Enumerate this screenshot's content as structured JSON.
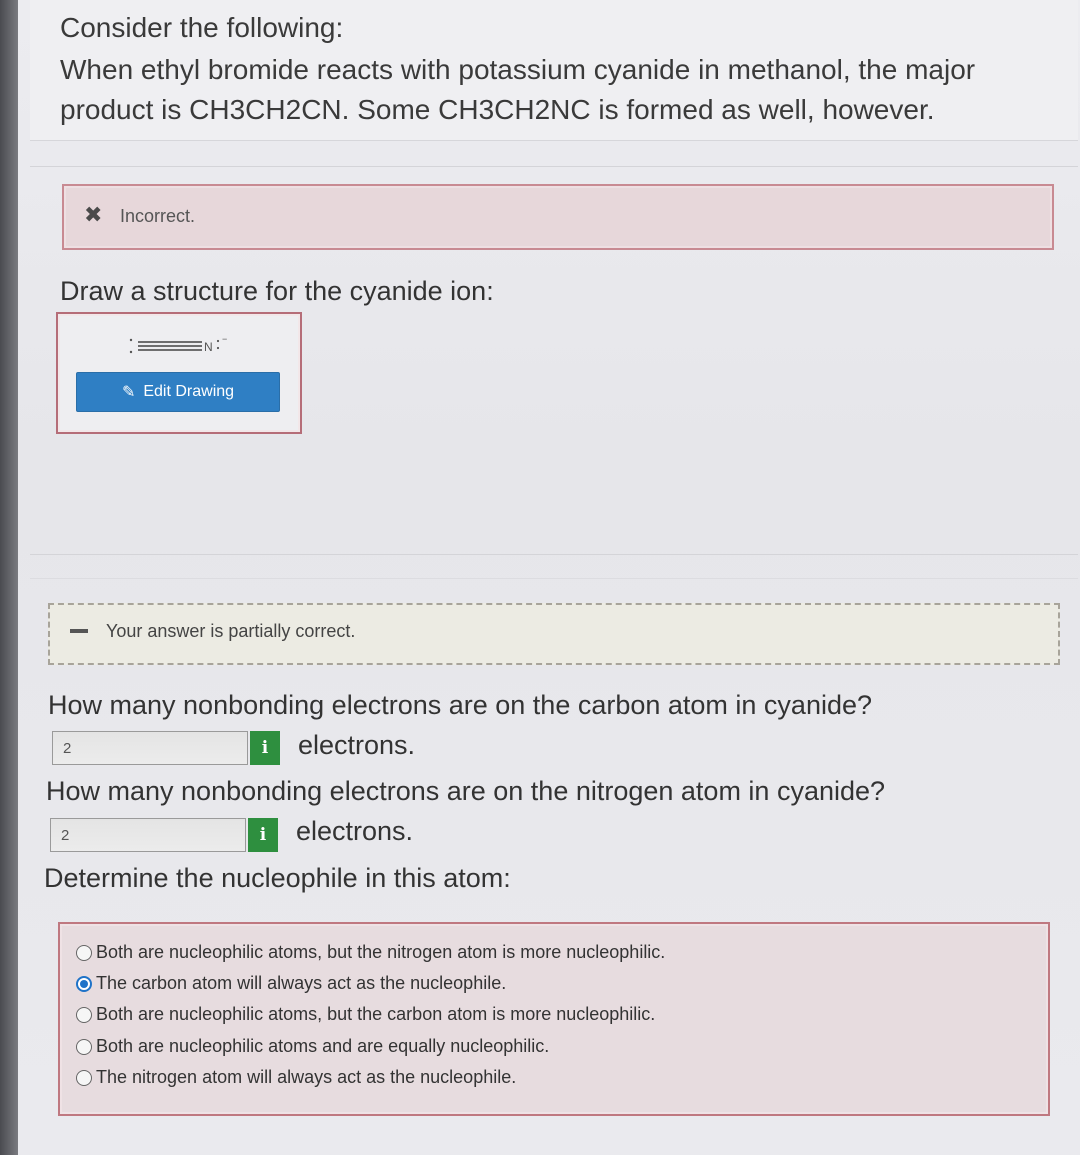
{
  "intro": {
    "title": "Consider the following:",
    "body": "When ethyl bromide reacts with potassium cyanide in methanol, the major product is CH3CH2CN. Some CH3CH2NC is formed as well, however."
  },
  "part1": {
    "feedback_text": "Incorrect.",
    "feedback_icon": "x-icon",
    "question": "Draw a structure for the cyanide ion:",
    "molecule_atom": "N",
    "molecule_charge": "−",
    "edit_button_label": "Edit Drawing",
    "edit_icon": "pencil-icon"
  },
  "part2": {
    "feedback_text": "Your answer is partially correct.",
    "feedback_icon": "dash-icon",
    "q1": {
      "question": "How many nonbonding electrons are on the carbon atom in cyanide?",
      "value": "2",
      "info": "i",
      "unit": "electrons."
    },
    "q2": {
      "question": "How many nonbonding electrons are on the nitrogen atom in cyanide?",
      "value": "2",
      "info": "i",
      "unit": "electrons."
    },
    "q3": {
      "question": "Determine the nucleophile in this atom:",
      "options": [
        {
          "label": "Both are nucleophilic atoms, but the nitrogen atom is more nucleophilic.",
          "selected": false
        },
        {
          "label": "The carbon atom will always act as the nucleophile.",
          "selected": true
        },
        {
          "label": "Both are nucleophilic atoms, but the carbon atom is more nucleophilic.",
          "selected": false
        },
        {
          "label": "Both are nucleophilic atoms and are equally nucleophilic.",
          "selected": false
        },
        {
          "label": "The nitrogen atom will always act as the nucleophile.",
          "selected": false
        }
      ]
    }
  },
  "colors": {
    "button_blue": "#2f7fc4",
    "info_green": "#2e8f3f",
    "error_border": "#bf7880",
    "radio_selected": "#1f73c8"
  }
}
